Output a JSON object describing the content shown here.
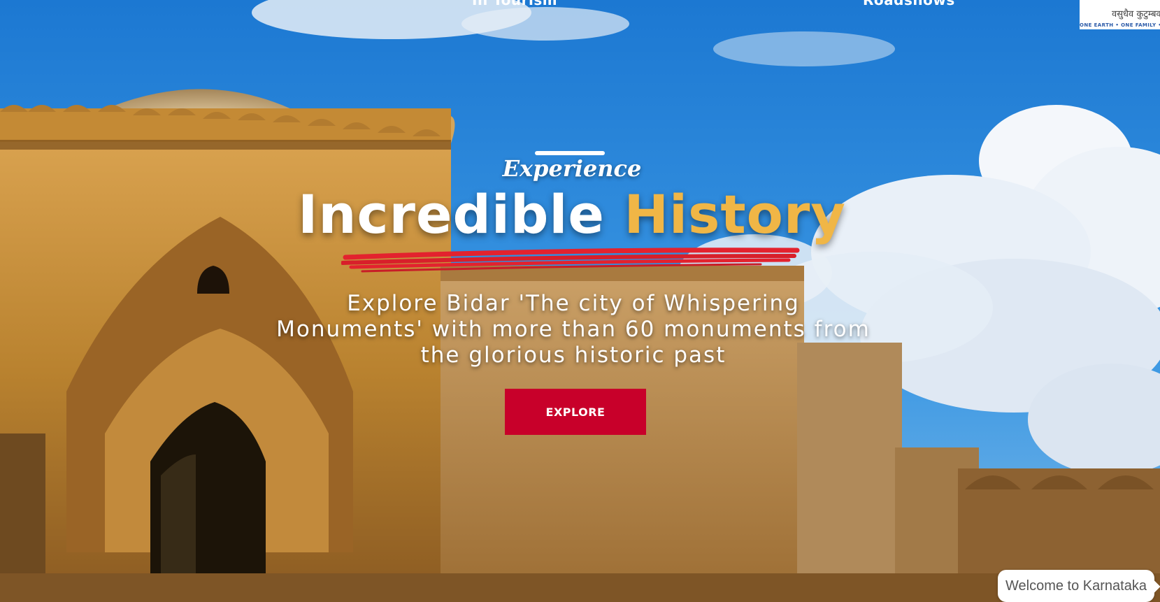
{
  "nav": {
    "left_link": "In Tourism",
    "right_link": "Roadshows"
  },
  "badge": {
    "line1": "वसुधैव कुटुम्बकम्",
    "line2": "ONE EARTH • ONE FAMILY • ONE FUTURE"
  },
  "hero": {
    "eyebrow": "Experience",
    "title_white": "Incredible",
    "title_gold": "History",
    "description": "Explore Bidar 'The city of Whispering Monuments' with more than 60 monuments from the glorious historic past",
    "cta_label": "EXPLORE"
  },
  "chat": {
    "label": "Welcome to Karnataka"
  },
  "colors": {
    "accent_gold": "#f0b646",
    "cta_red": "#c8002a",
    "brush_red": "#e3222e"
  }
}
